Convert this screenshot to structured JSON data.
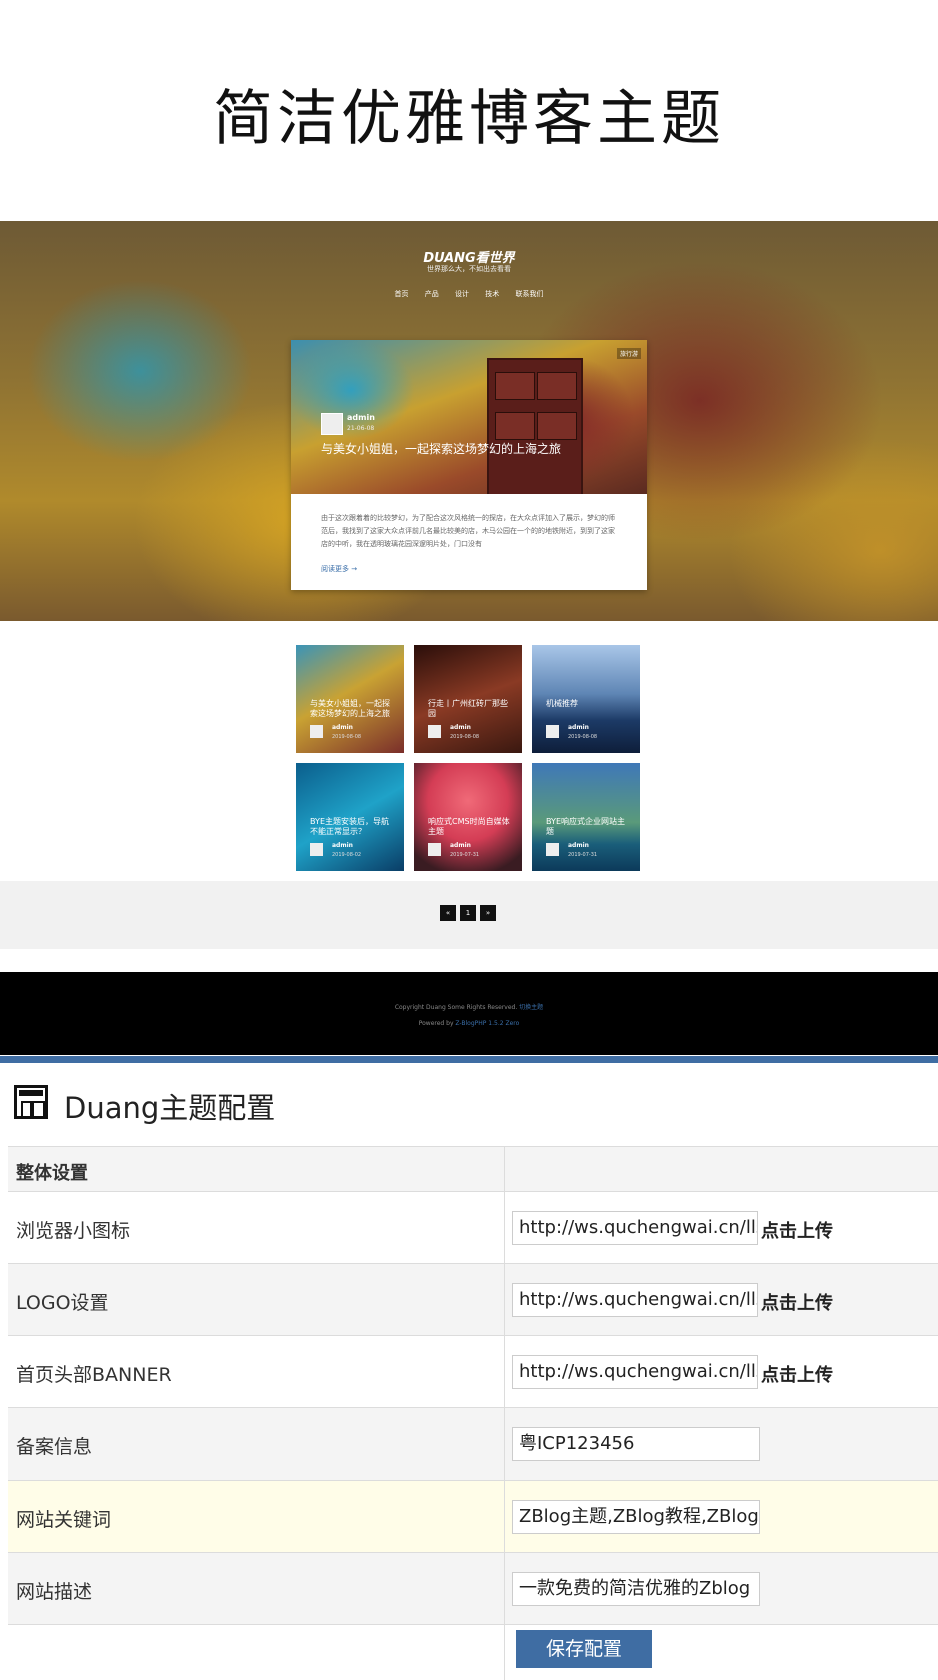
{
  "banner_title": "简洁优雅博客主题",
  "site": {
    "logo": "DUANG看世界",
    "slogan": "世界那么大，不如出去看看",
    "nav": [
      "首页",
      "产品",
      "设计",
      "技术",
      "联系我们"
    ]
  },
  "featured": {
    "tag": "旅行游",
    "author": "admin",
    "date": "21-06-08",
    "title": "与美女小姐姐，一起探索这场梦幻的上海之旅",
    "excerpt": "由于这次跟着着的比较梦幻，为了配合这次风格统一的探店，在大众点评加入了展示，梦幻的师范后，我找到了这家大众点评前几名最比较美的店，木马公园在一个的的地铁附近，到到了这家店的中听，我在透明玻璃花园深邃明片处，门口没有",
    "more": "阅读更多 →"
  },
  "posts": [
    {
      "title": "与美女小姐姐，一起探索这场梦幻的上海之旅",
      "author": "admin",
      "date": "2019-08-08"
    },
    {
      "title": "行走丨广州红砖厂那些园",
      "author": "admin",
      "date": "2019-08-08"
    },
    {
      "title": "机械推荐",
      "author": "admin",
      "date": "2019-08-08"
    },
    {
      "title": "BYE主题安装后，导航不能正常显示？",
      "author": "admin",
      "date": "2019-08-02"
    },
    {
      "title": "响应式CMS时尚自媒体主题",
      "author": "admin",
      "date": "2019-07-31"
    },
    {
      "title": "BYE响应式企业网站主题",
      "author": "admin",
      "date": "2019-07-31"
    }
  ],
  "pager": [
    "«",
    "1",
    "»"
  ],
  "footer": {
    "copyright": "Copyright Duang Some Rights Reserved.",
    "copyright_link": "切换主题",
    "powered": "Powered by",
    "powered_link": "Z-BlogPHP 1.5.2 Zero"
  },
  "config": {
    "title": "Duang主题配置",
    "section": "整体设置",
    "rows": [
      {
        "label": "浏览器小图标",
        "value": "http://ws.quchengwai.cn/lls/",
        "upload": "点击上传"
      },
      {
        "label": "LOGO设置",
        "value": "http://ws.quchengwai.cn/lls/",
        "upload": "点击上传"
      },
      {
        "label": "首页头部BANNER",
        "value": "http://ws.quchengwai.cn/lls/",
        "upload": "点击上传"
      },
      {
        "label": "备案信息",
        "value": "粤ICP123456"
      },
      {
        "label": "网站关键词",
        "value": "ZBlog主题,ZBlog教程,ZBlog"
      },
      {
        "label": "网站描述",
        "value": "一款免费的简洁优雅的Zblog"
      }
    ],
    "save": "保存配置"
  },
  "colors": {
    "accent": "#3f6da3",
    "highlight_row": "#fffde8",
    "stripe_row": "#f4f4f4"
  }
}
